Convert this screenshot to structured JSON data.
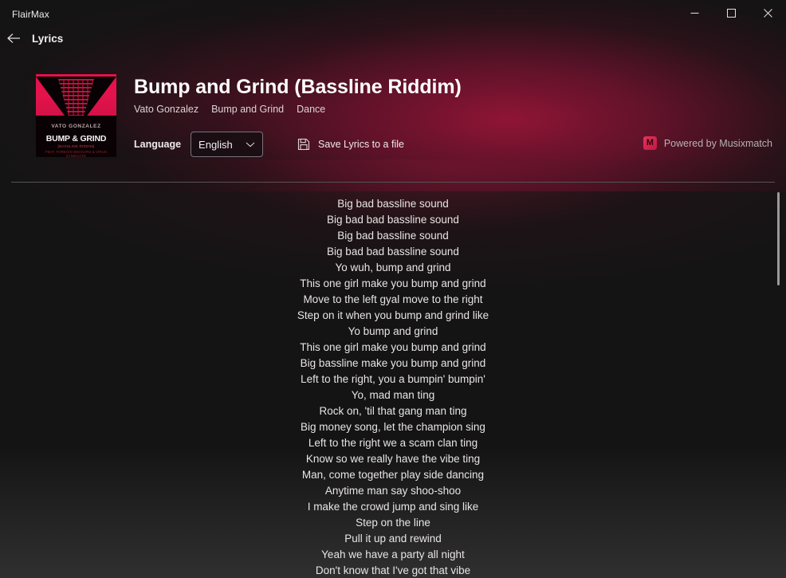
{
  "window": {
    "app_title": "FlairMax",
    "minimize_label": "Minimize",
    "maximize_label": "Maximize",
    "close_label": "Close"
  },
  "nav": {
    "back_label": "Back",
    "page_title": "Lyrics"
  },
  "cover": {
    "artist_text": "VATO GONZALEZ",
    "title_text": "BUMP & GRIND",
    "sub_text": "[BASSLINE RIDDIM]",
    "sub2_text": "FEAT. FOREIGN BEGGARS & VIRUS SYNDICATE"
  },
  "song": {
    "title": "Bump and Grind (Bassline Riddim)",
    "meta": [
      "Vato Gonzalez",
      "Bump and Grind",
      "Dance"
    ]
  },
  "controls": {
    "language_label": "Language",
    "language_value": "English",
    "language_options": [
      "English"
    ],
    "save_label": "Save Lyrics to a file",
    "save_icon": "floppy-disk-icon",
    "chevron_icon": "chevron-down-icon"
  },
  "attribution": {
    "logo_glyph": "M",
    "logo_color": "#e8335c",
    "label": "Powered by Musixmatch"
  },
  "lyrics": {
    "lines": [
      "Big bad bassline sound",
      "Big bad bad bassline sound",
      "Big bad bassline sound",
      "Big bad bad bassline sound",
      "Yo wuh, bump and grind",
      "This one girl make you bump and grind",
      "Move to the left gyal move to the right",
      "Step on it when you bump and grind like",
      "Yo bump and grind",
      "This one girl make you bump and grind",
      "Big bassline make you bump and grind",
      "Left to the right, you a bumpin' bumpin'",
      "Yo, mad man ting",
      "Rock on, 'til that gang man ting",
      "Big money song, let the champion sing",
      "Left to the right we a scam clan ting",
      "Know so we really have the vibe ting",
      "Man, come together play side dancing",
      "Anytime man say shoo-shoo",
      "I make the crowd jump and sing like",
      "Step on the line",
      "Pull it up and rewind",
      "Yeah we have a party all night",
      "Don't know that I've got that vibe"
    ]
  },
  "scrollbar": {
    "name": "lyrics-scrollbar"
  },
  "theme": {
    "accent": "#e8104a",
    "background": "#141414",
    "glow": "#96143 7",
    "text": "#e9e4e6"
  }
}
